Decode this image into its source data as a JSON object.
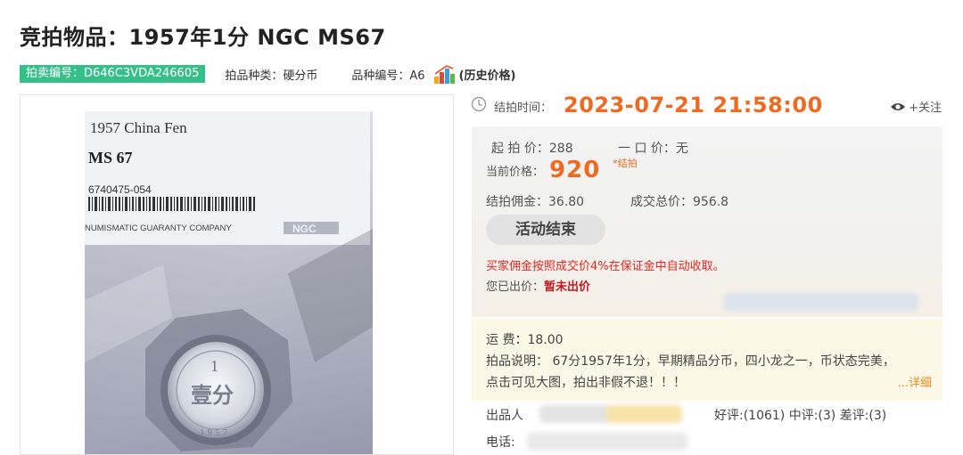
{
  "title": "竞拍物品：1957年1分 NGC MS67",
  "meta": {
    "lot_number": "拍卖编号：D646C3VDA246605",
    "category": "拍品种类：硬分币",
    "item_code": "品种编号：A6",
    "history_link": "(历史价格)"
  },
  "photo": {
    "slab_line1": "1957 China Fen",
    "slab_grade": "MS 67",
    "slab_cert": "6740475-054",
    "slab_company": "NUMISMATIC GUARANTY COMPANY",
    "slab_logo": "NGC",
    "coin_value": "1",
    "coin_text": "壹分",
    "coin_year": "1957"
  },
  "auction": {
    "end_time_label": "结拍时间：",
    "end_time": "2023-07-21 21:58:00",
    "follow_label": "+关注",
    "start_price": "起 拍 价：288",
    "buy_now": "一 口 价：无",
    "current_price_label": "当前价格：",
    "current_price": "920",
    "closed_tag": "*结拍",
    "commission": "结拍佣金：36.80",
    "total_price": "成交总价：956.8",
    "status_button": "活动结束",
    "notice": "买家佣金按照成交价4%在保证金中自动收取。",
    "my_bid_label": "您已出价：",
    "my_bid_value": "暂未出价"
  },
  "info": {
    "shipping": "运 费：18.00",
    "description": "拍品说明： 67分1957年1分，早期精品分币，四小龙之一，币状态完美，",
    "description2": "点击可见大图，拍出非假不退！！！",
    "more_link": "...详细"
  },
  "seller": {
    "label": "出品人",
    "ratings": "好评:(1061) 中评:(3) 差评:(3)",
    "phone_label": "电话:"
  },
  "colors": {
    "accent": "#ef6a1f",
    "badge": "#35c089",
    "warn": "#e8261f"
  }
}
